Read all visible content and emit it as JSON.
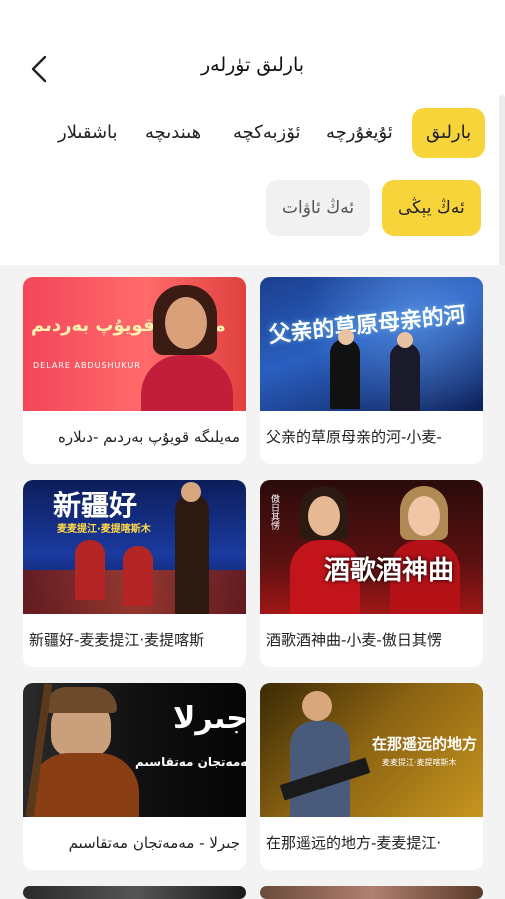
{
  "header": {
    "title": "بارلىق تۈرلەر"
  },
  "tabs": [
    {
      "label": "بارلىق",
      "active": true
    },
    {
      "label": "ئۇيغۇرچە",
      "active": false
    },
    {
      "label": "ئۆزبەكچە",
      "active": false
    },
    {
      "label": "ھىندىچە",
      "active": false
    },
    {
      "label": "باشقىلار",
      "active": false
    }
  ],
  "subtabs": [
    {
      "label": "ئەڭ يېڭى",
      "active": true
    },
    {
      "label": "ئەڭ ئاۋات",
      "active": false
    }
  ],
  "cards": [
    {
      "caption": "父亲的草原母亲的河-小麦-",
      "thumb_text": "父亲的草原母亲的河",
      "thumb_sub": ""
    },
    {
      "caption": "مەيلىگە قويۇپ بەردىم -دىلارە",
      "thumb_text": "مەيلىگە قويۇپ بەردىم",
      "thumb_sub": "DELARE ABDUSHUKUR"
    },
    {
      "caption": "酒歌酒神曲-小麦-傲日其愣",
      "thumb_text": "酒歌酒神曲",
      "thumb_sub": "傲日其愣"
    },
    {
      "caption": "新疆好-麦麦提江·麦提喀斯",
      "thumb_text": "新疆好",
      "thumb_sub": "麦麦提江·麦提喀斯木"
    },
    {
      "caption": "在那遥远的地方-麦麦提江·",
      "thumb_text": "在那遥远的地方",
      "thumb_sub": "麦麦提江·麦提喀斯木"
    },
    {
      "caption": "جىرلا - مەمەتجان مەتقاسىم",
      "thumb_text": "جىرلا",
      "thumb_sub": "مەمەتجان مەتقاسىم"
    }
  ],
  "colors": {
    "accent": "#f8d43b",
    "background": "#f3f3f3",
    "card": "#ffffff"
  }
}
